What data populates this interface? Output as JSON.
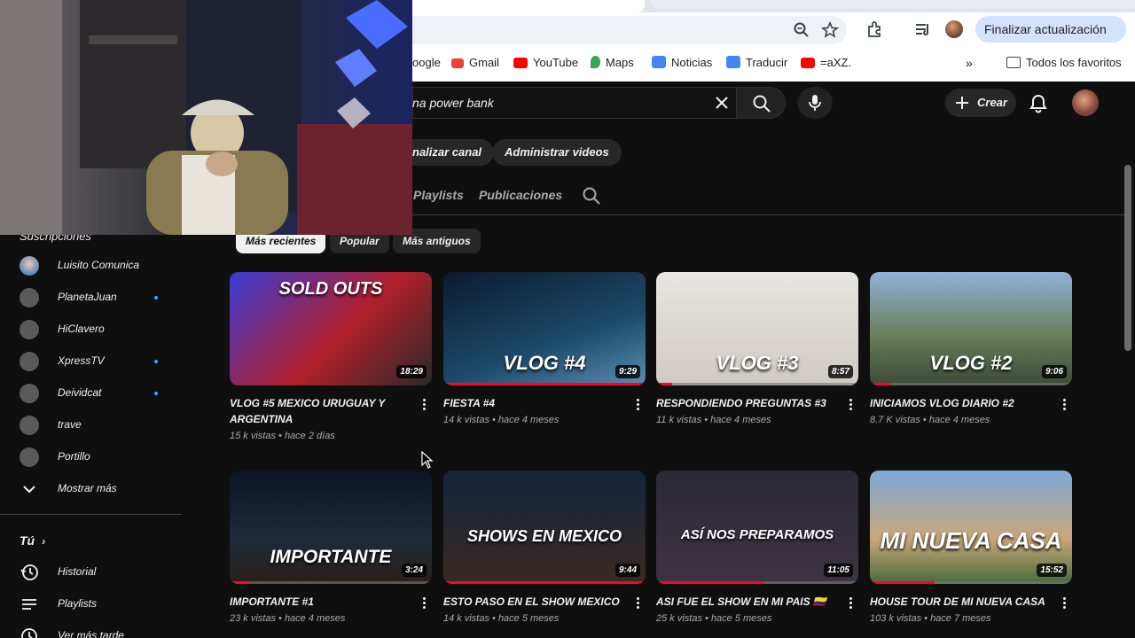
{
  "browser": {
    "update_button": "Finalizar actualización",
    "bookmarks": [
      {
        "label": "oogle",
        "color": "#4285f4"
      },
      {
        "label": "Gmail",
        "color": "#ea4335"
      },
      {
        "label": "YouTube",
        "color": "#ff0000"
      },
      {
        "label": "Maps",
        "color": "#34a853"
      },
      {
        "label": "Noticias",
        "color": "#4285f4"
      },
      {
        "label": "Traducir",
        "color": "#4285f4"
      },
      {
        "label": "=aXZ.",
        "color": "#ff0000"
      }
    ],
    "all_bookmarks": "Todos los favoritos",
    "more": "»"
  },
  "masthead": {
    "search_value": "na power bank",
    "create_label": "Crear"
  },
  "channel": {
    "buttons": [
      "nalizar canal",
      "Administrar videos"
    ],
    "tabs": [
      "Playlists",
      "Publicaciones"
    ],
    "chips": [
      "Más recientes",
      "Popular",
      "Más antiguos"
    ]
  },
  "sidebar": {
    "section_title": "Suscripciones",
    "subscriptions": [
      {
        "name": "Luisito Comunica",
        "dot": false
      },
      {
        "name": "PlanetaJuan",
        "dot": true
      },
      {
        "name": "HiClavero",
        "dot": false
      },
      {
        "name": "XpressTV",
        "dot": true
      },
      {
        "name": "Deividcat",
        "dot": true
      },
      {
        "name": "trave",
        "dot": false
      },
      {
        "name": "Portillo",
        "dot": false
      }
    ],
    "show_more": "Mostrar más",
    "you_section": "Tú",
    "you_items": [
      "Historial",
      "Playlists",
      "Ver más tarde"
    ]
  },
  "videos": [
    {
      "title": "VLOG #5 MEXICO URUGUAY Y ARGENTINA",
      "views": "15 k vistas",
      "age": "hace 2 días",
      "duration": "18:29",
      "overlay": "SOLD OUTS",
      "progress": 0
    },
    {
      "title": "FIESTA #4",
      "views": "14 k vistas",
      "age": "hace 4 meses",
      "duration": "9:29",
      "overlay": "VLOG #4",
      "progress": 1.0
    },
    {
      "title": "RESPONDIENDO PREGUNTAS #3",
      "views": "11 k vistas",
      "age": "hace 4 meses",
      "duration": "8:57",
      "overlay": "VLOG #3",
      "progress": 0.08
    },
    {
      "title": "INICIAMOS VLOG DIARIO #2",
      "views": "8.7 K vistas",
      "age": "hace 4 meses",
      "duration": "9:06",
      "overlay": "VLOG #2",
      "progress": 0.1
    },
    {
      "title": "IMPORTANTE #1",
      "views": "23 k vistas",
      "age": "hace 4 meses",
      "duration": "3:24",
      "overlay": "IMPORTANTE",
      "progress": 0.1
    },
    {
      "title": "ESTO PASO EN EL SHOW MEXICO",
      "views": "14 k vistas",
      "age": "hace 5 meses",
      "duration": "9:44",
      "overlay": "SHOWS EN MEXICO",
      "progress": 1.0
    },
    {
      "title": "ASI FUE EL SHOW EN MI PAIS 🇨🇴",
      "views": "25 k vistas",
      "age": "hace 5 meses",
      "duration": "11:05",
      "overlay": "ASÍ NOS PREPARAMOS",
      "progress": 0.53
    },
    {
      "title": "HOUSE TOUR DE MI NUEVA CASA",
      "views": "103 k vistas",
      "age": "hace 7 meses",
      "duration": "15:52",
      "overlay": "MI NUEVA CASA",
      "progress": 0.32
    }
  ],
  "colors": {
    "background": "#0f0f0f",
    "accent": "#ff0033",
    "new_dot": "#3ea6ff"
  }
}
